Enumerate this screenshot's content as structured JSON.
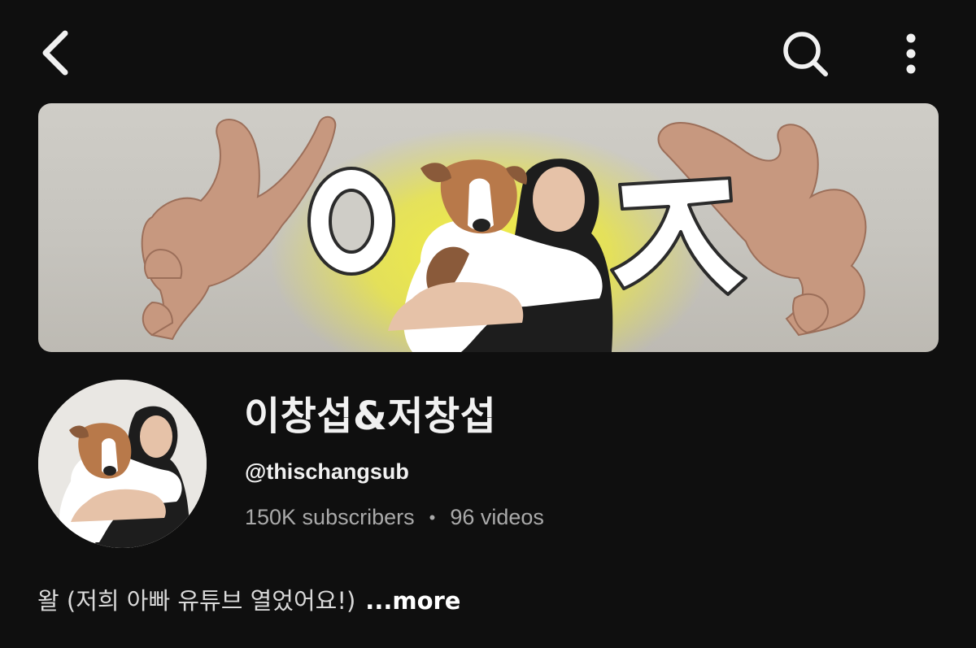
{
  "header": {
    "back_icon": "chevron-left-icon",
    "search_icon": "search-icon",
    "more_icon": "more-vertical-icon"
  },
  "banner": {
    "left_glyph": "ㅇ",
    "right_glyph": "ㅈ",
    "glow_color": "#f3ee3a"
  },
  "channel": {
    "name": "이창섭&저창섭",
    "handle": "@thischangsub",
    "subscribers": "150K subscribers",
    "separator": "•",
    "videos": "96 videos",
    "description": "왈 (저희 아빠 유튜브 열었어요!)",
    "more_label": "...more"
  },
  "colors": {
    "background": "#0f0f0f",
    "primary_text": "#f1f1f1",
    "secondary_text": "#aaaaaa"
  }
}
